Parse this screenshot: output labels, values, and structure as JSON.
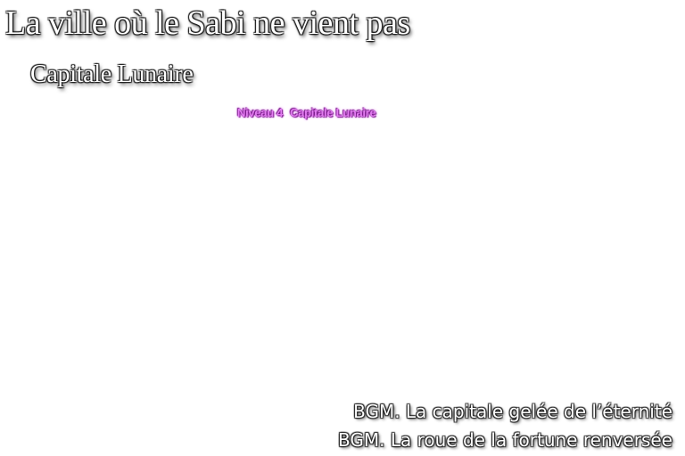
{
  "title": "La ville où le Sabi ne vient pas",
  "subtitle": "Capitale Lunaire",
  "stage": {
    "level": "Niveau 4",
    "name": "Capitale Lunaire"
  },
  "bgm": [
    "BGM. La capitale gelée de l’éternité",
    "BGM. La roue de la fortune renversée"
  ],
  "colors": {
    "background": "#ffffff",
    "title_text": "#ffffff",
    "title_outline": "#1a1a1a",
    "stage_label": "#e27cf0"
  }
}
